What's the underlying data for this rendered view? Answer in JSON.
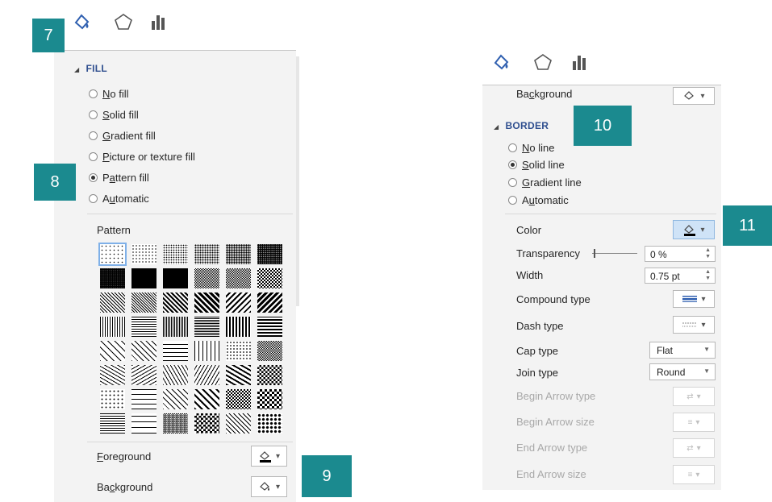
{
  "callouts": {
    "c7": "7",
    "c8": "8",
    "c9": "9",
    "c10": "10",
    "c11": "11"
  },
  "left": {
    "fill_header": "FILL",
    "options": [
      {
        "label": "No fill",
        "u": "N",
        "rest": "o fill",
        "selected": false
      },
      {
        "label": "Solid fill",
        "u": "S",
        "rest": "olid fill",
        "selected": false
      },
      {
        "label": "Gradient fill",
        "u": "G",
        "rest": "radient fill",
        "selected": false
      },
      {
        "label": "Picture or texture fill",
        "u": "P",
        "rest": "icture or texture fill",
        "selected": false
      },
      {
        "label": "Pattern fill",
        "pre": "P",
        "u": "a",
        "rest": "ttern fill",
        "selected": true
      },
      {
        "label": "Automatic",
        "pre": "A",
        "u": "u",
        "rest": "tomatic",
        "selected": false
      }
    ],
    "pattern_label": "Pattern",
    "foreground_label": "Foreground",
    "foreground_u": "F",
    "foreground_rest": "oreground",
    "background_label": "Background",
    "background_pre": "Ba",
    "background_u": "c",
    "background_rest": "kground"
  },
  "right": {
    "background_label": "Background",
    "background_pre": "Ba",
    "background_u": "c",
    "background_rest": "kground",
    "border_header": "BORDER",
    "options": [
      {
        "label": "No line",
        "u": "N",
        "rest": "o line",
        "selected": false
      },
      {
        "label": "Solid line",
        "u": "S",
        "rest": "olid line",
        "selected": true
      },
      {
        "label": "Gradient line",
        "u": "G",
        "rest": "radient line",
        "selected": false
      },
      {
        "label": "Automatic",
        "pre": "A",
        "u": "u",
        "rest": "tomatic",
        "selected": false
      }
    ],
    "color_label": "Color",
    "transparency_label": "Transparency",
    "transparency_value": "0 %",
    "width_label": "Width",
    "width_value": "0.75 pt",
    "compound_label": "Compound type",
    "dash_label": "Dash type",
    "cap_label": "Cap type",
    "cap_value": "Flat",
    "join_label": "Join type",
    "join_value": "Round",
    "begin_arrow_type_label": "Begin Arrow type",
    "begin_arrow_size_label": "Begin Arrow size",
    "end_arrow_type_label": "End Arrow type",
    "end_arrow_size_label": "End Arrow size"
  },
  "icons": {
    "fill_tab": "paint-bucket-icon",
    "effects_tab": "pentagon-icon",
    "size_tab": "bar-chart-icon",
    "dropdown": "chevron-down-icon"
  },
  "colors": {
    "callout": "#1b8a8f",
    "header": "#2f4f8f",
    "panel": "#f3f3f3"
  }
}
